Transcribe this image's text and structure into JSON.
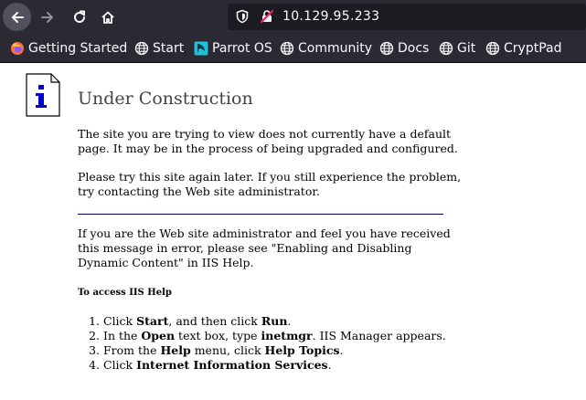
{
  "browser": {
    "url": "10.129.95.233",
    "bookmarks": [
      {
        "label": "Getting Started",
        "icon": "firefox-icon"
      },
      {
        "label": "Start",
        "icon": "globe-icon"
      },
      {
        "label": "Parrot OS",
        "icon": "parrot-icon"
      },
      {
        "label": "Community",
        "icon": "globe-icon"
      },
      {
        "label": "Docs",
        "icon": "globe-icon"
      },
      {
        "label": "Git",
        "icon": "globe-icon"
      },
      {
        "label": "CryptPad",
        "icon": "globe-icon"
      }
    ],
    "colors": {
      "toolbar": "#2b2a33",
      "urlbar": "#1c1b22",
      "text": "#fbfbfe",
      "lock_slash": "#e22850"
    }
  },
  "page": {
    "title": "Under Construction",
    "para1": "The site you are trying to view does not currently have a default page. It may be in the process of being upgraded and configured.",
    "para2": "Please try this site again later. If you still experience the problem, try contacting the Web site administrator.",
    "para3": "If you are the Web site administrator and feel you have received this message in error, please see \"Enabling and Disabling Dynamic Content\" in IIS Help.",
    "help_title": "To access IIS Help",
    "steps": [
      {
        "num": "1.",
        "parts": [
          "Click ",
          "Start",
          ", and then click ",
          "Run",
          "."
        ]
      },
      {
        "num": "2.",
        "parts": [
          "In the ",
          "Open",
          " text box, type ",
          "inetmgr",
          ". IIS Manager appears."
        ]
      },
      {
        "num": "3.",
        "parts": [
          "From the ",
          "Help",
          " menu, click ",
          "Help Topics",
          "."
        ]
      },
      {
        "num": "4.",
        "parts": [
          "Click ",
          "Internet Information Services",
          ".",
          "",
          ""
        ]
      }
    ]
  }
}
